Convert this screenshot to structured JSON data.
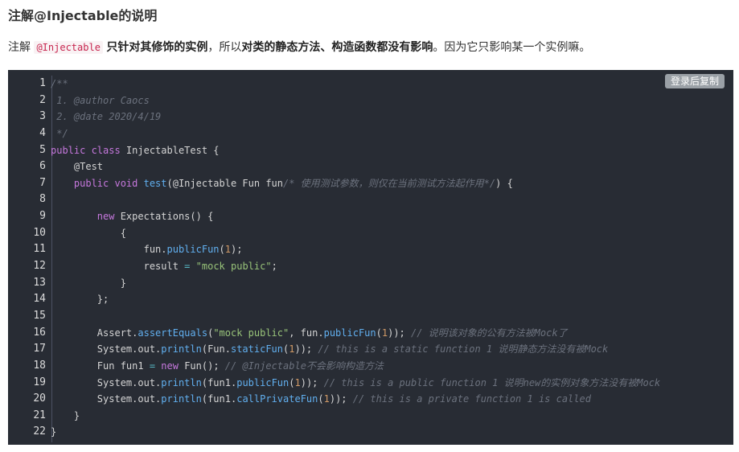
{
  "heading": "注解@Injectable的说明",
  "paragraph": {
    "part1": "注解 ",
    "code": "@Injectable",
    "part2": " ",
    "bold1": "只针对其修饰的实例",
    "part3": "，所以",
    "bold2": "对类的静态方法、构造函数都没有影响",
    "part4": "。因为它只影响某一个实例嘛。"
  },
  "code_block": {
    "copy_button_label": "登录后复制",
    "line_numbers": [
      "1",
      "2",
      "3",
      "4",
      "5",
      "6",
      "7",
      "8",
      "9",
      "10",
      "11",
      "12",
      "13",
      "14",
      "15",
      "16",
      "17",
      "18",
      "19",
      "20",
      "21",
      "22"
    ],
    "lines": {
      "l1": "/**",
      "l2": " 1. @author Caocs",
      "l3": " 2. @date 2020/4/19",
      "l4": " */",
      "l5": {
        "a": "public class",
        "b": " InjectableTest {"
      },
      "l6": "    @Test",
      "l7": {
        "a": "    public void ",
        "b": "test",
        "c": "(@Injectable Fun fun",
        "d": "/* 使用测试参数，则仅在当前测试方法起作用*/",
        "e": ") {"
      },
      "l8": "",
      "l9": {
        "a": "        ",
        "b": "new",
        "c": " Expectations() {"
      },
      "l10": "            {",
      "l11": {
        "a": "                fun.",
        "b": "publicFun",
        "c": "(",
        "d": "1",
        "e": ");"
      },
      "l12": {
        "a": "                result ",
        "b": "=",
        "c": " ",
        "d": "\"mock public\"",
        "e": ";"
      },
      "l13": "            }",
      "l14": "        };",
      "l15": "",
      "l16": {
        "a": "        Assert.",
        "b": "assertEquals",
        "c": "(",
        "d": "\"mock public\"",
        "e": ", fun.",
        "f": "publicFun",
        "g": "(",
        "h": "1",
        "i": ")); ",
        "j": "// 说明该对象的公有方法被Mock了"
      },
      "l17": {
        "a": "        System.out.",
        "b": "println",
        "c": "(Fun.",
        "d": "staticFun",
        "e": "(",
        "f": "1",
        "g": ")); ",
        "h": "// this is a static function 1 说明静态方法没有被Mock"
      },
      "l18": {
        "a": "        Fun fun1 ",
        "b": "=",
        "c": " ",
        "d": "new",
        "e": " Fun(); ",
        "f": "// @Injectable不会影响构造方法"
      },
      "l19": {
        "a": "        System.out.",
        "b": "println",
        "c": "(fun1.",
        "d": "publicFun",
        "e": "(",
        "f": "1",
        "g": ")); ",
        "h": "// this is a public function 1 说明new的实例对象方法没有被Mock"
      },
      "l20": {
        "a": "        System.out.",
        "b": "println",
        "c": "(fun1.",
        "d": "callPrivateFun",
        "e": "(",
        "f": "1",
        "g": ")); ",
        "h": "// this is a private function 1 is called"
      },
      "l21": "    }",
      "l22": "}"
    }
  }
}
